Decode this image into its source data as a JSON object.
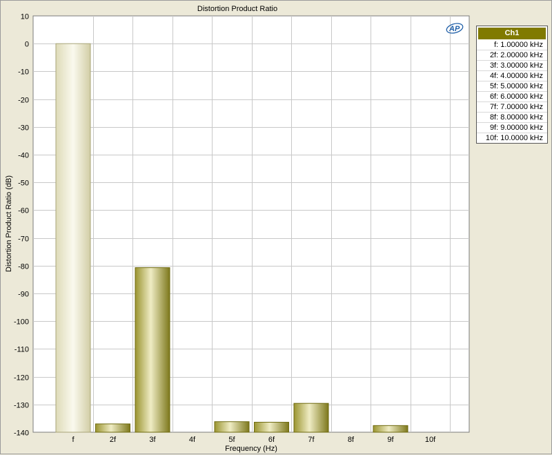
{
  "window": {
    "title": "Distortion Product Ratio"
  },
  "chart_data": {
    "type": "bar",
    "title": "Distortion Product Ratio",
    "xlabel": "Frequency (Hz)",
    "ylabel": "Distortion Product Ratio (dB)",
    "categories": [
      "f",
      "2f",
      "3f",
      "4f",
      "5f",
      "6f",
      "7f",
      "8f",
      "9f",
      "10f"
    ],
    "series": [
      {
        "name": "Ch1",
        "values": [
          0,
          -137,
          -80.7,
          -140,
          -136.2,
          -136.4,
          -129.6,
          -140,
          -137.6,
          -140
        ]
      }
    ],
    "ylim": [
      -140,
      10
    ],
    "yticks": [
      10,
      0,
      -10,
      -20,
      -30,
      -40,
      -50,
      -60,
      -70,
      -80,
      -90,
      -100,
      -110,
      -120,
      -130,
      -140
    ],
    "grid": true,
    "legend_position": "right"
  },
  "legend": {
    "header": "Ch1",
    "items": [
      "f: 1.00000 kHz",
      "2f: 2.00000 kHz",
      "3f: 3.00000 kHz",
      "4f: 4.00000 kHz",
      "5f: 5.00000 kHz",
      "6f: 6.00000 kHz",
      "7f: 7.00000 kHz",
      "8f: 8.00000 kHz",
      "9f: 9.00000 kHz",
      "10f: 10.0000 kHz"
    ]
  },
  "logo": {
    "text": "AP",
    "color": "#1f5fa8"
  },
  "colors": {
    "bar_dark": "#8a8420",
    "bar_light": "#ece9c0",
    "bar_fundamental_light": "#f6f5e6",
    "bar_fundamental_dark": "#d4d0a8",
    "grid": "#c8c8c8",
    "plot_bg": "#ffffff"
  }
}
